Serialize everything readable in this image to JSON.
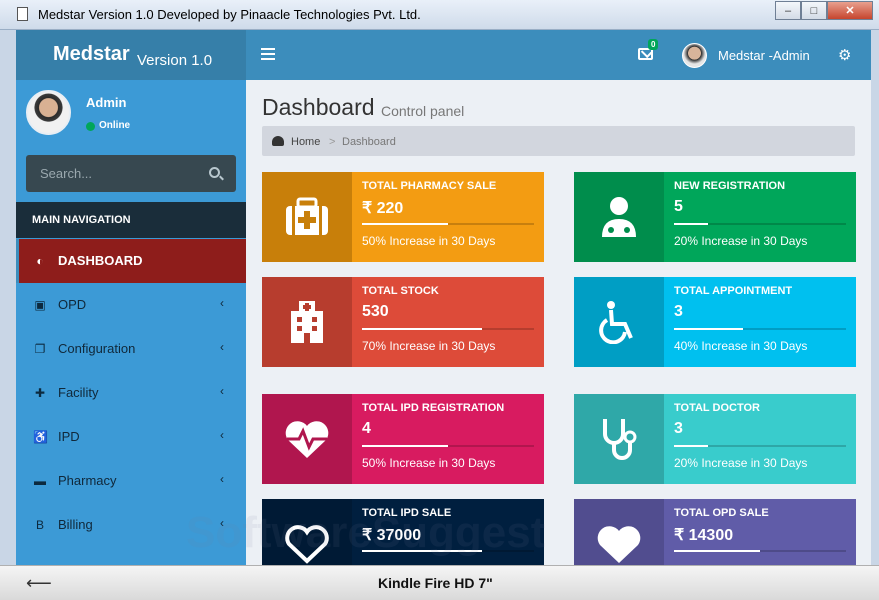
{
  "window": {
    "title": "Medstar Version 1.0 Developed by Pinaacle Technologies Pvt. Ltd.",
    "minimize": "–",
    "maximize": "□",
    "close": "✕"
  },
  "header": {
    "brand": "Medstar",
    "version": "Version 1.0",
    "mail_badge": "0",
    "user_name": "Medstar -Admin"
  },
  "sidebar": {
    "profile_name": "Admin",
    "status": "Online",
    "search_placeholder": "Search...",
    "nav_header": "MAIN NAVIGATION",
    "items": [
      {
        "label": "DASHBOARD",
        "icon": "dashboard-icon",
        "glyph": "◐",
        "active": true
      },
      {
        "label": "OPD",
        "icon": "medkit-icon",
        "glyph": "▣",
        "active": false
      },
      {
        "label": "Configuration",
        "icon": "config-icon",
        "glyph": "❐",
        "active": false
      },
      {
        "label": "Facility",
        "icon": "plus-square-icon",
        "glyph": "✚",
        "active": false
      },
      {
        "label": "IPD",
        "icon": "wheelchair-icon",
        "glyph": "♿",
        "active": false
      },
      {
        "label": "Pharmacy",
        "icon": "bed-icon",
        "glyph": "▬",
        "active": false
      },
      {
        "label": "Billing",
        "icon": "billing-icon",
        "glyph": "B",
        "active": false
      }
    ]
  },
  "content": {
    "title": "Dashboard",
    "subtitle": "Control panel",
    "breadcrumb": {
      "home": "Home",
      "separator": ">",
      "current": "Dashboard"
    }
  },
  "boxes": [
    {
      "title": "TOTAL PHARMACY SALE",
      "value": "₹ 220",
      "desc": "50% Increase in 30 Days",
      "progress": 0.5,
      "color": "#f39c12",
      "icon_bg": "#c87f0a",
      "icon": "medkit-icon"
    },
    {
      "title": "NEW REGISTRATION",
      "value": "5",
      "desc": "20% Increase in 30 Days",
      "progress": 0.2,
      "color": "#00a65a",
      "icon_bg": "#008d4c",
      "icon": "user-md-icon"
    },
    {
      "title": "TOTAL STOCK",
      "value": "530",
      "desc": "70% Increase in 30 Days",
      "progress": 0.7,
      "color": "#dd4b39",
      "icon_bg": "#b73d2e",
      "icon": "hospital-icon"
    },
    {
      "title": "TOTAL APPOINTMENT",
      "value": "3",
      "desc": "40% Increase in 30 Days",
      "progress": 0.4,
      "color": "#00c0ef",
      "icon_bg": "#009ec4",
      "icon": "wheelchair-icon"
    },
    {
      "title": "TOTAL IPD REGISTRATION",
      "value": "4",
      "desc": "50% Increase in 30 Days",
      "progress": 0.5,
      "color": "#d81b60",
      "icon_bg": "#b0164e",
      "icon": "heartbeat-icon"
    },
    {
      "title": "TOTAL DOCTOR",
      "value": "3",
      "desc": "20% Increase in 30 Days",
      "progress": 0.2,
      "color": "#39cccc",
      "icon_bg": "#2fa8a8",
      "icon": "stethoscope-icon"
    },
    {
      "title": "TOTAL IPD SALE",
      "value": "₹ 37000",
      "desc": "",
      "progress": 0.7,
      "color": "#001f3f",
      "icon_bg": "#001a35",
      "icon": "heart-outline-icon"
    },
    {
      "title": "TOTAL OPD SALE",
      "value": "₹ 14300",
      "desc": "",
      "progress": 0.5,
      "color": "#605ca8",
      "icon_bg": "#514d8f",
      "icon": "heart-icon"
    }
  ],
  "footer": {
    "back": "⟵",
    "device": "Kindle Fire HD 7\""
  },
  "watermark": "SoftwareSuggest"
}
